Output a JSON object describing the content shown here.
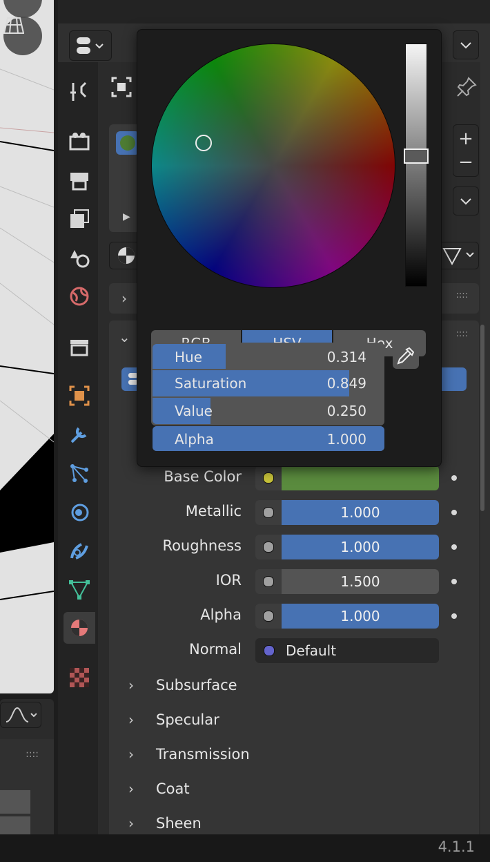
{
  "popup": {
    "modes": [
      "RGB",
      "HSV",
      "Hex"
    ],
    "active_mode": "HSV",
    "sliders": [
      {
        "label": "Hue",
        "value": "0.314",
        "fraction": 0.314
      },
      {
        "label": "Saturation",
        "value": "0.849",
        "fraction": 0.849
      },
      {
        "label": "Value",
        "value": "0.250",
        "fraction": 0.25
      },
      {
        "label": "Alpha",
        "value": "1.000",
        "fraction": 1.0
      }
    ],
    "eyedropper_icon": "eyedropper-icon"
  },
  "properties": {
    "base_color": {
      "label": "Base Color",
      "color": "#5a8b3e"
    },
    "rows": [
      {
        "label": "Metallic",
        "value": "1.000"
      },
      {
        "label": "Roughness",
        "value": "1.000"
      },
      {
        "label": "IOR",
        "value": "1.500"
      },
      {
        "label": "Alpha",
        "value": "1.000"
      }
    ],
    "normal": {
      "label": "Normal",
      "value": "Default"
    },
    "subsections": [
      "Subsurface",
      "Specular",
      "Transmission",
      "Coat",
      "Sheen"
    ]
  },
  "tabs": [
    "tool-icon",
    "render-icon",
    "output-icon",
    "view-layer-icon",
    "scene-icon",
    "world-icon",
    "collection-icon",
    "object-icon",
    "modifier-icon",
    "particles-icon",
    "physics-icon",
    "constraints-icon",
    "data-icon",
    "material-icon",
    "texture-icon"
  ],
  "status": {
    "version": "4.1.1"
  },
  "colors": {
    "accent": "#4772b3",
    "panel": "#2b2b2b",
    "popup": "#1c1c1c"
  }
}
